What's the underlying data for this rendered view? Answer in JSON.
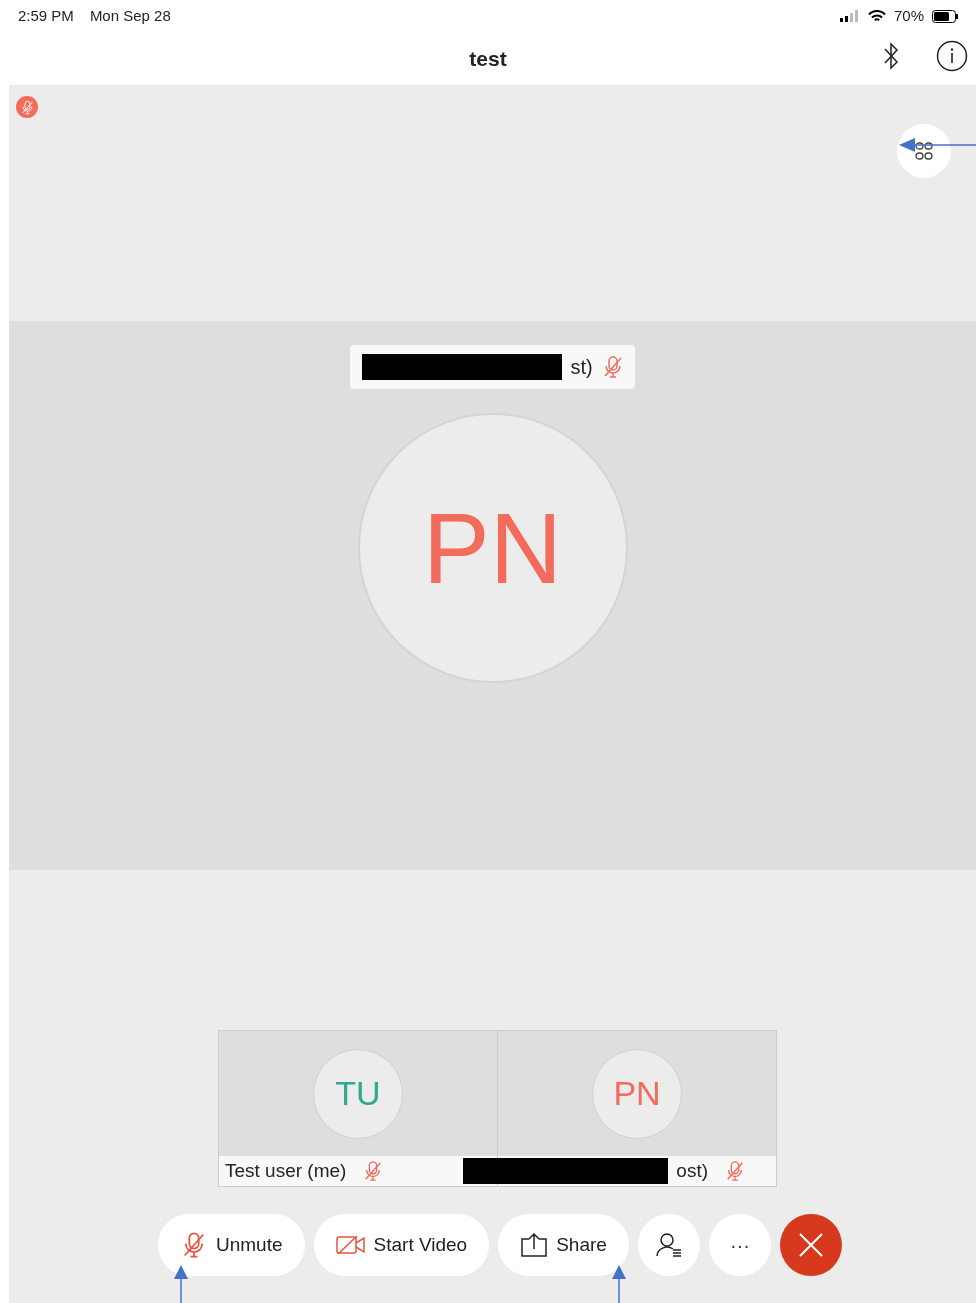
{
  "status_bar": {
    "time": "2:59 PM",
    "date": "Mon Sep 28",
    "battery": "70%"
  },
  "title": "test",
  "self_muted": true,
  "active_speaker": {
    "name": "st)",
    "initials": "PN",
    "color": "#f26b5b",
    "muted": true,
    "redacted": true
  },
  "participants": [
    {
      "name": "Test user (me)",
      "initials": "TU",
      "color": "#2ea88f",
      "muted": true,
      "redacted": false
    },
    {
      "name": "ost)",
      "initials": "PN",
      "color": "#f26b5b",
      "muted": true,
      "redacted": true
    }
  ],
  "controls": [
    {
      "kind": "mute",
      "label": "Unmute"
    },
    {
      "kind": "video",
      "label": "Start Video"
    },
    {
      "kind": "share",
      "label": "Share"
    },
    {
      "kind": "participants"
    },
    {
      "kind": "more",
      "label": "···"
    },
    {
      "kind": "leave"
    }
  ]
}
